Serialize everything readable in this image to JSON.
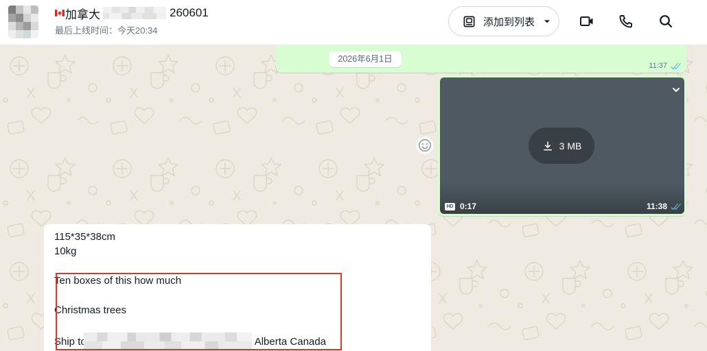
{
  "header": {
    "contact_name_prefix": "加拿大",
    "contact_name_suffix": "260601",
    "status": "最后上线时间：今天20:34",
    "add_to_list_label": "添加到列表",
    "icons": {
      "flag": "canada-flag-icon",
      "add_to_list": "contact-list-icon",
      "add_to_list_dropdown": "caret-down-icon",
      "video_call": "video-call-icon",
      "voice_call": "phone-icon",
      "search": "search-icon"
    }
  },
  "chat": {
    "date_chip": "2026年6月1日",
    "outgoing_top": {
      "time": "11:37",
      "receipt_icon": "double-check-read-icon"
    },
    "video_message": {
      "menu_icon": "chevron-down-icon",
      "download_icon": "download-icon",
      "download_size": "3 MB",
      "quality_badge": "HD",
      "duration": "0:17",
      "time": "11:38",
      "receipt_icon": "double-check-read-icon"
    },
    "reaction_icon": "emoji-smiley-icon",
    "incoming_message": {
      "lines": [
        "115*35*38cm",
        "10kg",
        "Ten boxes of this how much",
        "Christmas trees"
      ],
      "ship_prefix": "Ship to",
      "ship_suffix": "Alberta Canada"
    }
  },
  "colors": {
    "header_bg": "#ffffff",
    "chat_bg": "#efeae2",
    "outgoing_bubble": "#d9fdd3",
    "incoming_bubble": "#ffffff",
    "video_thumbnail": "#4e5961",
    "read_receipt": "#53bdeb",
    "annotation_border": "#e0332d"
  }
}
